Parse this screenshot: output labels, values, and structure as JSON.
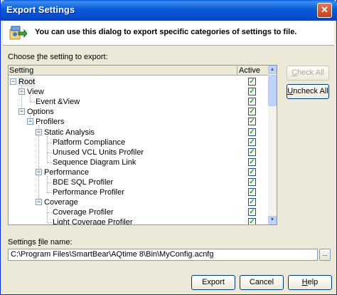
{
  "window": {
    "title": "Export Settings",
    "close_glyph": "✕"
  },
  "header": {
    "text": "You can use this dialog to export specific categories of settings to file.",
    "icon": "export-settings-icon"
  },
  "tree": {
    "label_pre": "Choose ",
    "label_accel": "t",
    "label_post": "he setting to export:",
    "col_setting": "Setting",
    "col_active": "Active",
    "rows": [
      {
        "label": "Root",
        "checked": true
      },
      {
        "label": "View",
        "checked": true
      },
      {
        "label": "Event &View",
        "checked": true
      },
      {
        "label": "Options",
        "checked": true
      },
      {
        "label": "Profilers",
        "checked": true
      },
      {
        "label": "Static Analysis",
        "checked": true
      },
      {
        "label": "Platform Compliance",
        "checked": true
      },
      {
        "label": "Unused VCL Units Profiler",
        "checked": true
      },
      {
        "label": "Sequence Diagram Link",
        "checked": true
      },
      {
        "label": "Performance",
        "checked": true
      },
      {
        "label": "BDE SQL Profiler",
        "checked": true
      },
      {
        "label": "Performance Profiler",
        "checked": true
      },
      {
        "label": "Coverage",
        "checked": true
      },
      {
        "label": "Coverage Profiler",
        "checked": true
      },
      {
        "label": "Light Coverage Profiler",
        "checked": true
      }
    ]
  },
  "buttons": {
    "check_all_pre": "",
    "check_all_accel": "C",
    "check_all_post": "heck All",
    "uncheck_all_pre": "",
    "uncheck_all_accel": "U",
    "uncheck_all_post": "ncheck All",
    "export": "Export",
    "cancel": "Cancel",
    "help_pre": "",
    "help_accel": "H",
    "help_post": "elp"
  },
  "file": {
    "label_pre": "Settings ",
    "label_accel": "f",
    "label_post": "ile name:",
    "value": "C:\\Program Files\\SmartBear\\AQtime 8\\Bin\\MyConfig.acnfg",
    "browse": "..."
  },
  "glyphs": {
    "collapse": "−",
    "check": "✓",
    "scroll_up": "▲",
    "scroll_down": "▼"
  }
}
